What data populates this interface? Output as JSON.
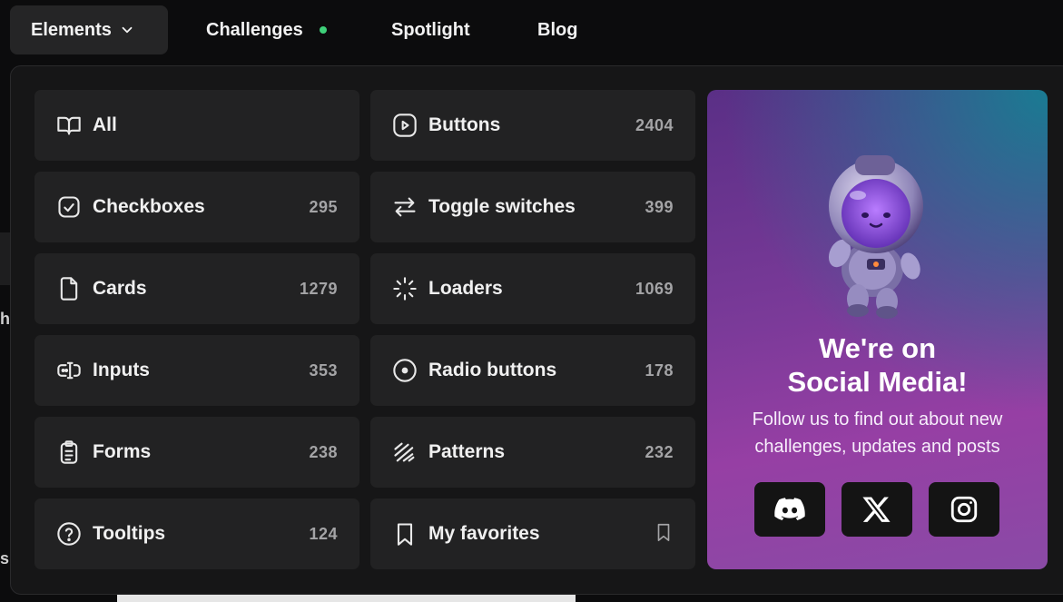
{
  "nav": {
    "items": [
      {
        "label": "Elements"
      },
      {
        "label": "Challenges"
      },
      {
        "label": "Spotlight"
      },
      {
        "label": "Blog"
      }
    ]
  },
  "background": {
    "fragment_1": "h",
    "fragment_2": "s"
  },
  "menu": {
    "left": [
      {
        "label": "All",
        "count": "",
        "icon": "book-open-icon"
      },
      {
        "label": "Checkboxes",
        "count": "295",
        "icon": "checkbox-icon"
      },
      {
        "label": "Cards",
        "count": "1279",
        "icon": "file-icon"
      },
      {
        "label": "Inputs",
        "count": "353",
        "icon": "input-cursor-icon"
      },
      {
        "label": "Forms",
        "count": "238",
        "icon": "clipboard-list-icon"
      },
      {
        "label": "Tooltips",
        "count": "124",
        "icon": "help-circle-icon"
      }
    ],
    "right": [
      {
        "label": "Buttons",
        "count": "2404",
        "icon": "play-button-icon"
      },
      {
        "label": "Toggle switches",
        "count": "399",
        "icon": "arrows-swap-icon"
      },
      {
        "label": "Loaders",
        "count": "1069",
        "icon": "loader-icon"
      },
      {
        "label": "Radio buttons",
        "count": "178",
        "icon": "radio-icon"
      },
      {
        "label": "Patterns",
        "count": "232",
        "icon": "pattern-icon"
      },
      {
        "label": "My favorites",
        "count": "",
        "icon": "bookmark-icon"
      }
    ]
  },
  "promo": {
    "title_line1": "We're on",
    "title_line2": "Social Media!",
    "body": "Follow us to find out about new challenges, updates and posts",
    "socials": [
      "discord-icon",
      "x-icon",
      "instagram-icon"
    ]
  },
  "colors": {
    "accent_dot": "#3fd17a",
    "tile_bg": "#222223",
    "panel_bg": "#161617"
  }
}
